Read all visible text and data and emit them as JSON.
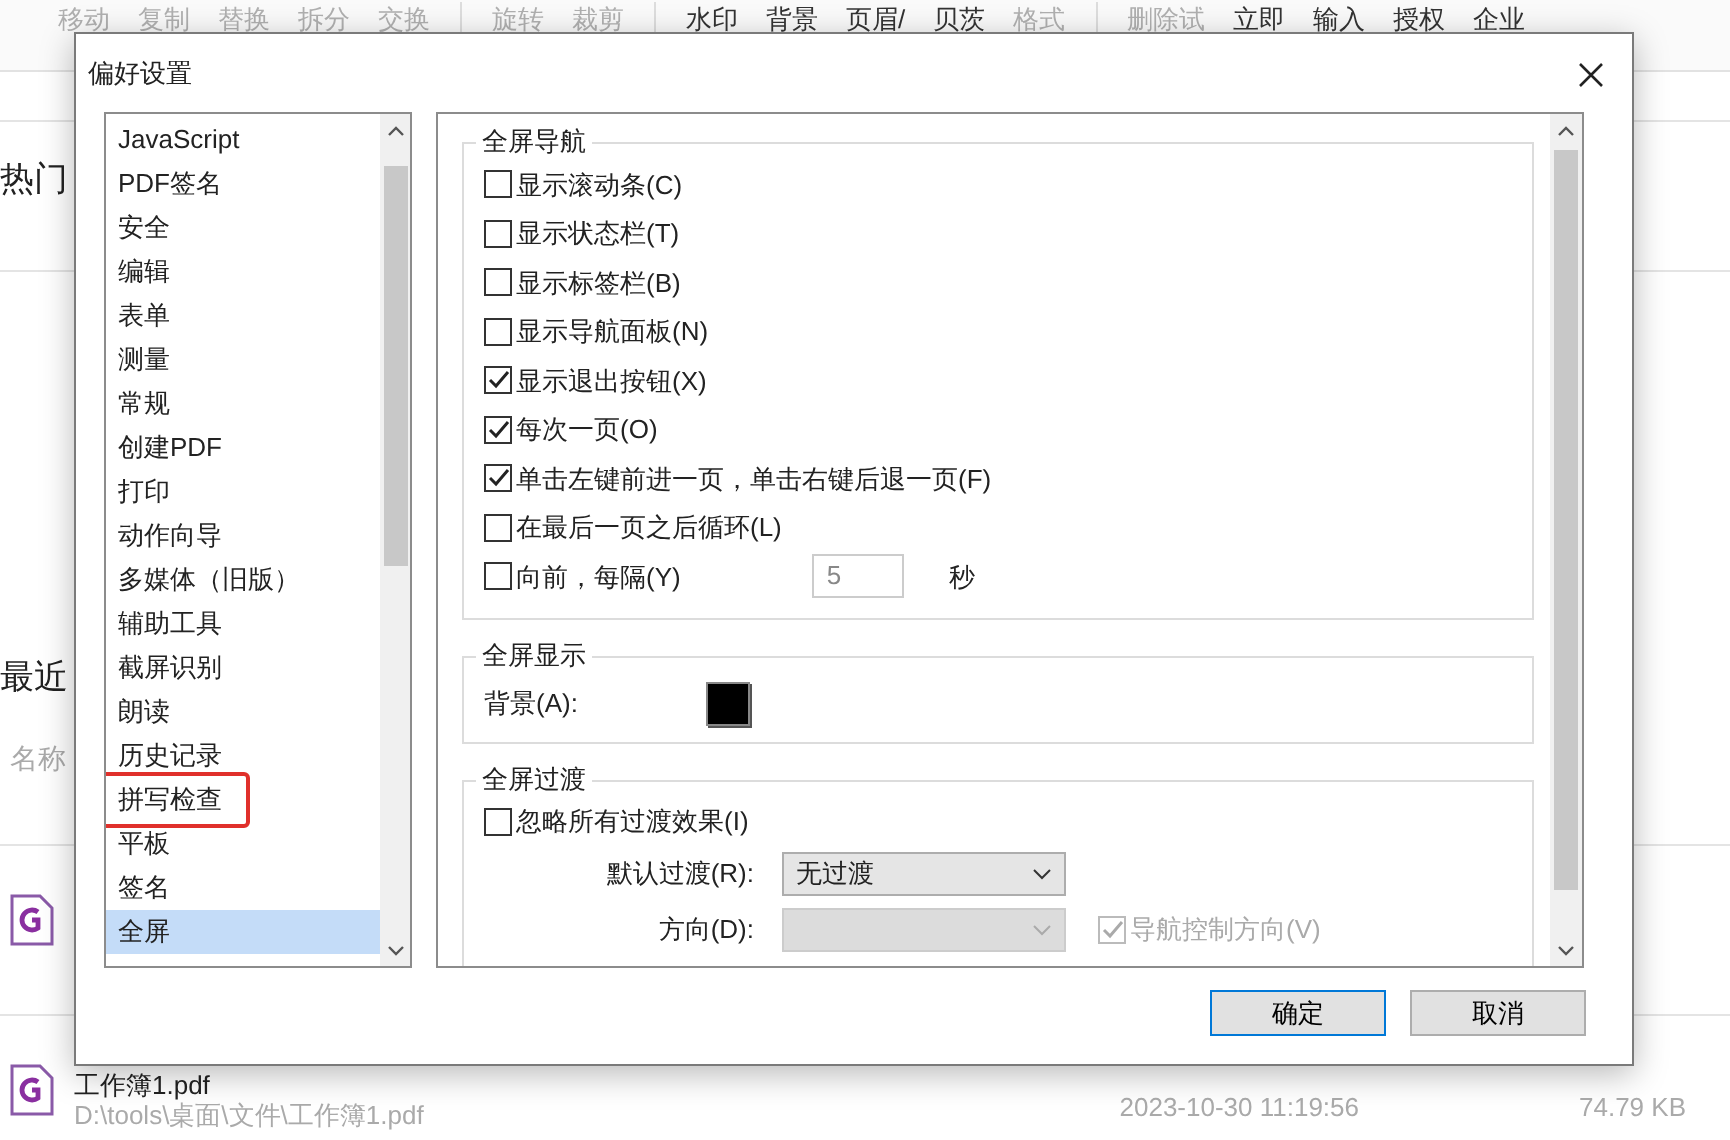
{
  "toolbar": [
    {
      "label": "移动",
      "disabled": true
    },
    {
      "label": "复制",
      "disabled": true
    },
    {
      "label": "替换",
      "disabled": true
    },
    {
      "label": "拆分",
      "disabled": true
    },
    {
      "label": "交换",
      "disabled": true,
      "group_end": true
    },
    {
      "label": "旋转",
      "disabled": true
    },
    {
      "label": "裁剪",
      "disabled": true,
      "group_end": true
    },
    {
      "label": "水印",
      "disabled": false
    },
    {
      "label": "背景",
      "disabled": false
    },
    {
      "label": "页眉/",
      "disabled": false
    },
    {
      "label": "贝茨",
      "disabled": false
    },
    {
      "label": "格式",
      "disabled": true,
      "group_end": true
    },
    {
      "label": "删除试",
      "disabled": true
    },
    {
      "label": "立即",
      "disabled": false
    },
    {
      "label": "输入",
      "disabled": false
    },
    {
      "label": "授权",
      "disabled": false
    },
    {
      "label": "企业",
      "disabled": false
    }
  ],
  "home": {
    "hot_title": "热门",
    "recent_title": "最近",
    "name_header": "名称",
    "files": [
      {
        "covered": true
      },
      {
        "covered": false,
        "name": "工作簿1.pdf",
        "path": "D:\\tools\\桌面\\文件\\工作簿1.pdf",
        "date": "2023-10-30 11:19:56",
        "size": "74.79 KB"
      }
    ]
  },
  "dialog": {
    "title": "偏好设置",
    "categories": [
      {
        "label": "JavaScript",
        "selected": false,
        "annotated": false
      },
      {
        "label": "PDF签名",
        "selected": false,
        "annotated": false
      },
      {
        "label": "安全",
        "selected": false,
        "annotated": false
      },
      {
        "label": "编辑",
        "selected": false,
        "annotated": false
      },
      {
        "label": "表单",
        "selected": false,
        "annotated": false
      },
      {
        "label": "测量",
        "selected": false,
        "annotated": false
      },
      {
        "label": "常规",
        "selected": false,
        "annotated": false
      },
      {
        "label": "创建PDF",
        "selected": false,
        "annotated": false
      },
      {
        "label": "打印",
        "selected": false,
        "annotated": false
      },
      {
        "label": "动作向导",
        "selected": false,
        "annotated": false
      },
      {
        "label": "多媒体（旧版）",
        "selected": false,
        "annotated": false
      },
      {
        "label": "辅助工具",
        "selected": false,
        "annotated": false
      },
      {
        "label": "截屏识别",
        "selected": false,
        "annotated": false
      },
      {
        "label": "朗读",
        "selected": false,
        "annotated": false
      },
      {
        "label": "历史记录",
        "selected": false,
        "annotated": false
      },
      {
        "label": "拼写检查",
        "selected": false,
        "annotated": true
      },
      {
        "label": "平板",
        "selected": false,
        "annotated": false
      },
      {
        "label": "签名",
        "selected": false,
        "annotated": false
      },
      {
        "label": "全屏",
        "selected": true,
        "annotated": false
      }
    ],
    "sections": [
      {
        "kind": "checks",
        "title": "全屏导航",
        "options": [
          {
            "label": "显示滚动条(C)",
            "checked": false
          },
          {
            "label": "显示状态栏(T)",
            "checked": false
          },
          {
            "label": "显示标签栏(B)",
            "checked": false
          },
          {
            "label": "显示导航面板(N)",
            "checked": false
          },
          {
            "label": "显示退出按钮(X)",
            "checked": true
          },
          {
            "label": "每次一页(O)",
            "checked": true
          },
          {
            "label": "单击左键前进一页，单击右键后退一页(F)",
            "checked": true
          },
          {
            "label": "在最后一页之后循环(L)",
            "checked": false
          },
          {
            "label": "向前，每隔(Y)",
            "checked": false,
            "interval": {
              "value": "5",
              "unit": "秒",
              "disabled": true
            }
          }
        ]
      },
      {
        "kind": "color",
        "title": "全屏显示",
        "label": "背景(A):",
        "color": "#000000"
      },
      {
        "kind": "transition",
        "title": "全屏过渡",
        "option": {
          "label": "忽略所有过渡效果(I)",
          "checked": false
        },
        "default_label": "默认过渡(R):",
        "default_value": "无过渡",
        "direction_label": "方向(D):",
        "direction_disabled": true,
        "nav_option": {
          "label": "导航控制方向(V)",
          "checked": true,
          "disabled": true
        }
      }
    ],
    "buttons": [
      {
        "label": "确定",
        "default": true
      },
      {
        "label": "取消",
        "default": false
      }
    ]
  }
}
